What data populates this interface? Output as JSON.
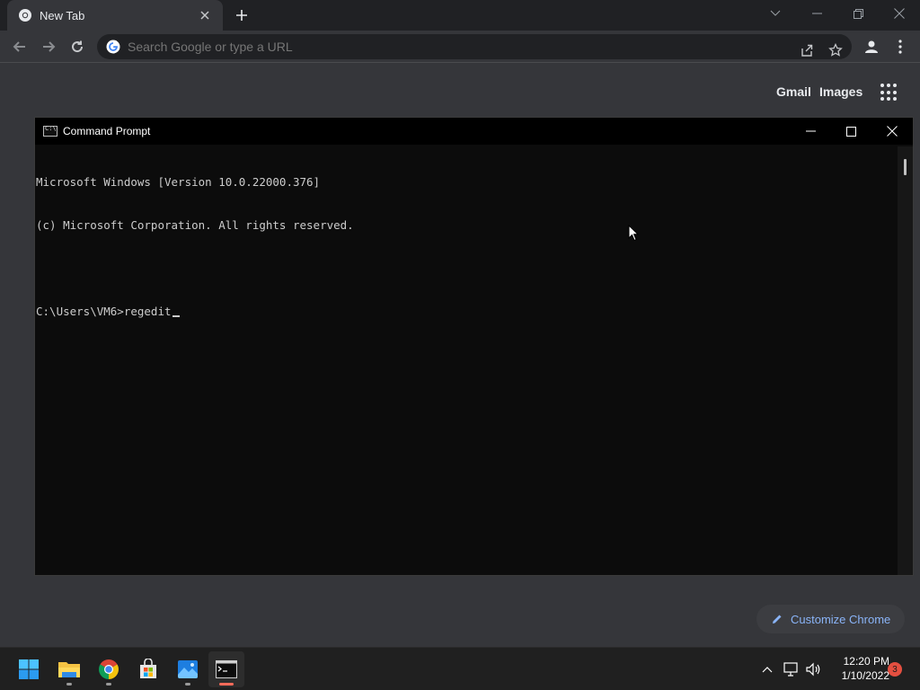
{
  "browser": {
    "tab": {
      "title": "New Tab"
    },
    "omnibox": {
      "placeholder": "Search Google or type a URL"
    }
  },
  "ntp": {
    "gmail": "Gmail",
    "images": "Images",
    "customize": "Customize Chrome"
  },
  "cmd": {
    "title": "Command Prompt",
    "lines": [
      "Microsoft Windows [Version 10.0.22000.376]",
      "(c) Microsoft Corporation. All rights reserved.",
      "",
      "C:\\Users\\VM6>regedit"
    ]
  },
  "taskbar": {
    "apps": [
      "start",
      "file-explorer",
      "chrome",
      "microsoft-store",
      "photos",
      "command-prompt"
    ],
    "time": "12:20 PM",
    "date": "1/10/2022",
    "notification_count": "3"
  },
  "colors": {
    "accent_link": "#8ab4f8",
    "console_text": "#cccccc",
    "badge": "#e44f40"
  }
}
